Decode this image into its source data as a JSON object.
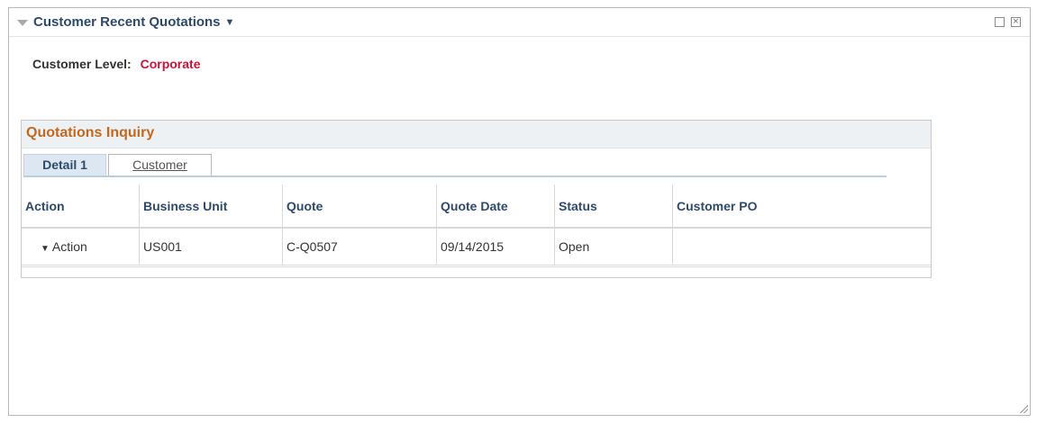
{
  "pagelet": {
    "title": "Customer Recent Quotations",
    "caret": "▼",
    "max_icon": "maximize-icon",
    "close_icon": "close-icon",
    "close_glyph": "×"
  },
  "customer_level": {
    "label": "Customer Level:",
    "value": "Corporate",
    "value_color": "#d0103a"
  },
  "grid": {
    "title": "Quotations Inquiry",
    "tabs": [
      {
        "label": "Detail 1",
        "active": true
      },
      {
        "label": "Customer",
        "active": false
      }
    ],
    "columns": [
      "Action",
      "Business Unit",
      "Quote",
      "Quote Date",
      "Status",
      "Customer PO"
    ],
    "rows": [
      {
        "action": "Action",
        "business_unit": "US001",
        "quote": "C-Q0507",
        "quote_date": "09/14/2015",
        "status": "Open",
        "customer_po": ""
      }
    ]
  }
}
